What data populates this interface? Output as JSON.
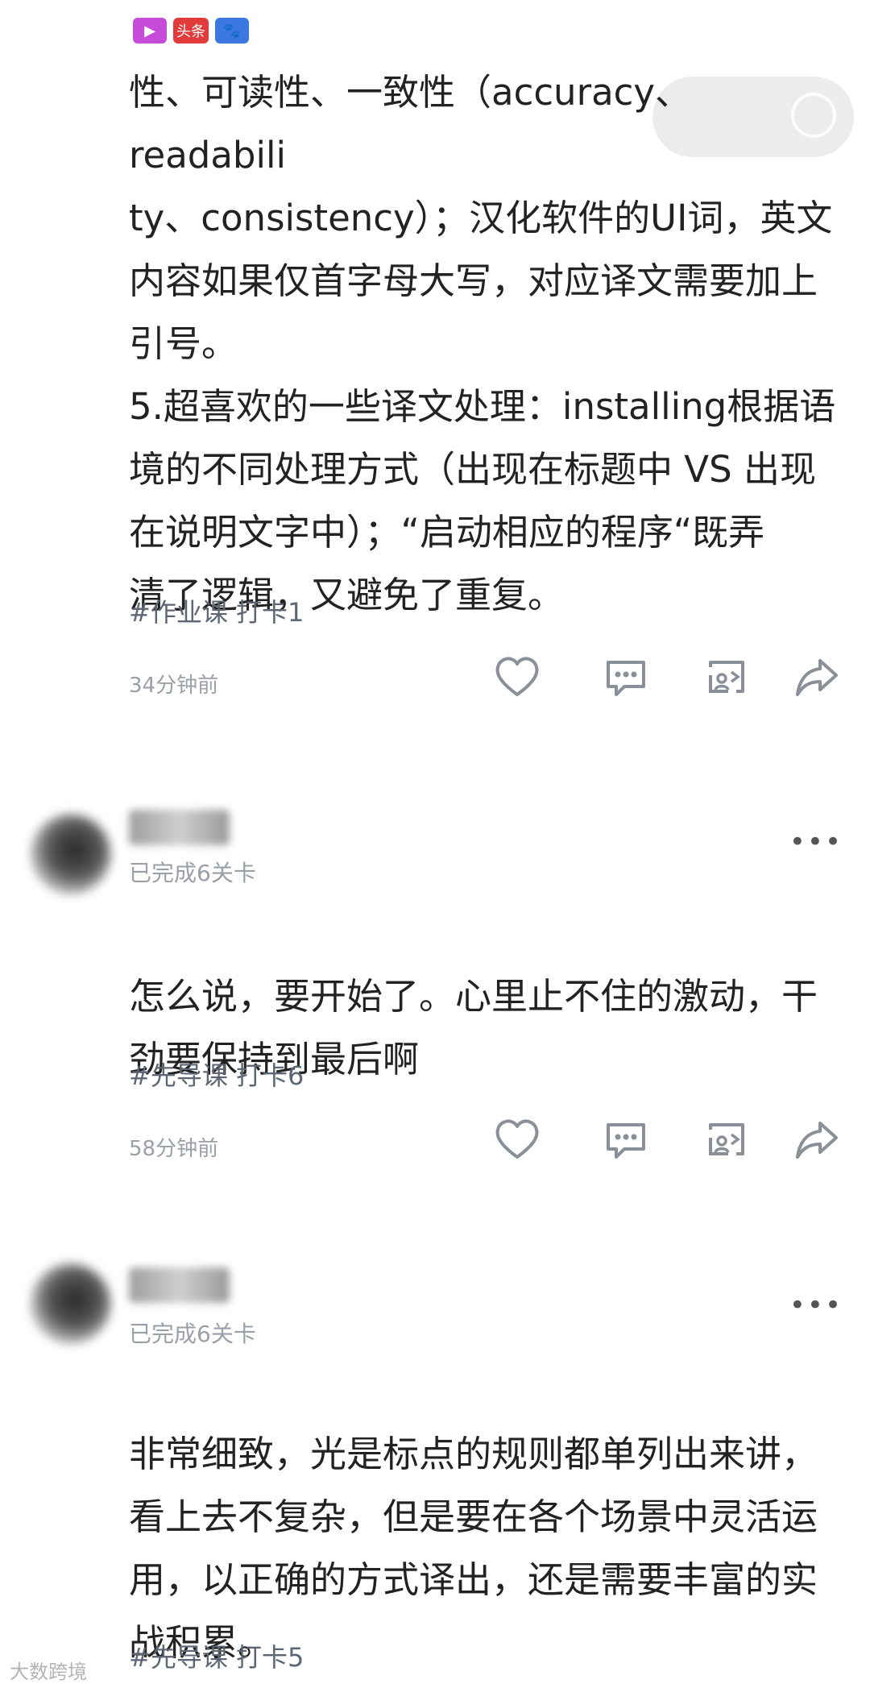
{
  "posts": [
    {
      "text_lines": [
        "性、可读性、一致性（accuracy、readabili",
        "ty、consistency）；汉化软件的UI词，英文",
        "内容如果仅首字母大写，对应译文需要加上",
        "引号。",
        "5.超喜欢的一些译文处理：installing根据语",
        "境的不同处理方式（出现在标题中 VS 出现",
        "在说明文字中）；“启动相应的程序“既弄",
        "清了逻辑，又避免了重复。"
      ],
      "tag": "#作业课 打卡1",
      "time": "34分钟前"
    },
    {
      "username": "",
      "level": "已完成6关卡",
      "more": "•••",
      "text_lines": [
        "怎么说，要开始了。心里止不住的激动，干",
        "劲要保持到最后啊"
      ],
      "tag": "#先导课 打卡6",
      "time": "58分钟前"
    },
    {
      "username": "",
      "level": "已完成6关卡",
      "more": "•••",
      "text_lines": [
        "非常细致，光是标点的规则都单列出来讲，",
        "看上去不复杂，但是要在各个场景中灵活运",
        "用，以正确的方式译出，还是需要丰富的实",
        "战积累。"
      ],
      "tag": "#先导课 打卡5"
    }
  ],
  "icons": [
    "heart-icon",
    "comment-icon",
    "repost-icon",
    "share-icon"
  ],
  "watermark": {
    "top_badge": "头条",
    "bottom_text": "大数跨境"
  },
  "colors": {
    "text": "#222222",
    "tag": "#5f6673",
    "time": "#9aa0a8",
    "icon": "#8a8f98"
  }
}
